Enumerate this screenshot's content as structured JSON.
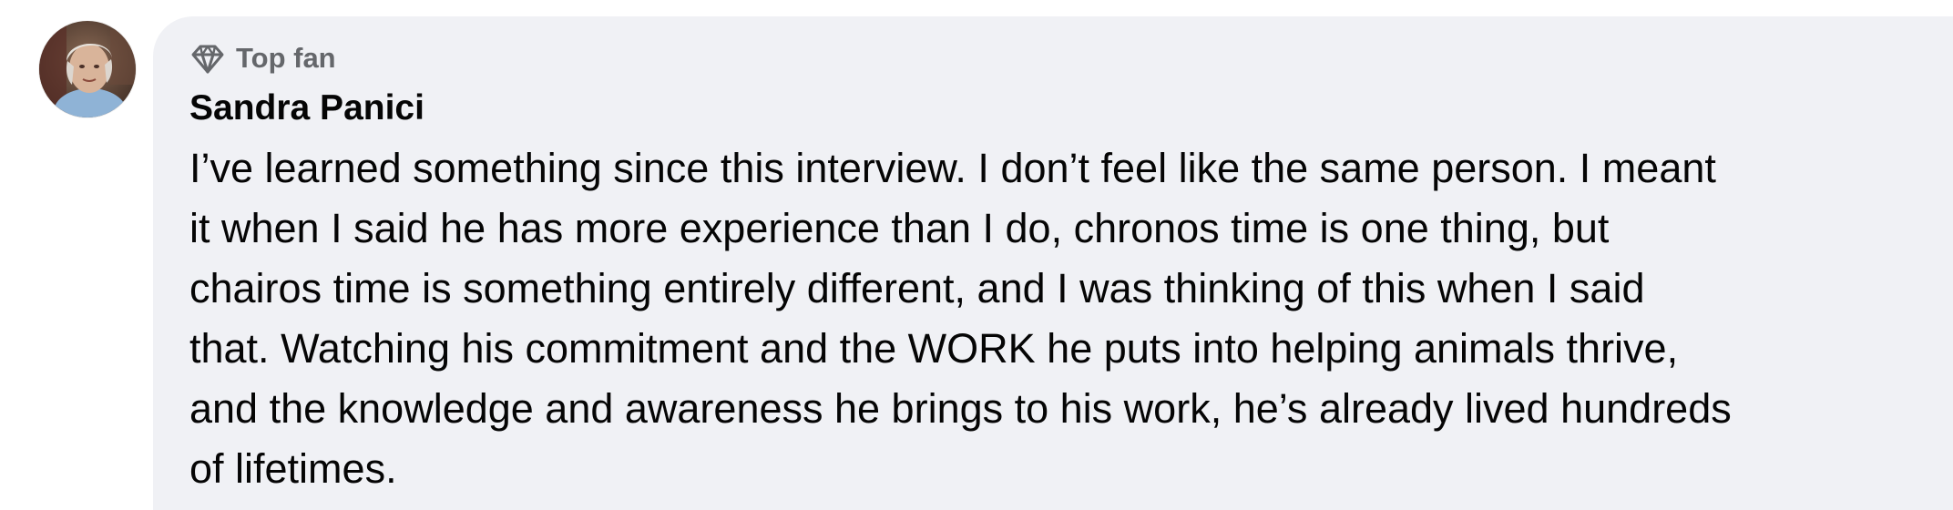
{
  "comment": {
    "badge": {
      "icon": "diamond-icon",
      "label": "Top fan"
    },
    "author": "Sandra Panici",
    "lines": [
      "I’ve learned something since this interview. I don’t feel like the same person. I meant",
      "it when I said he has more experience than I do, chronos time is one thing, but",
      "chairos time is something entirely different, and I was thinking of this when I said",
      "that. Watching his commitment and the WORK he puts into helping animals thrive,",
      "and the knowledge and awareness he brings to his work, he’s already lived hundreds",
      "of lifetimes."
    ]
  },
  "colors": {
    "bubble_background": "#f0f1f5",
    "secondary_text": "#65676b",
    "primary_text": "#050505"
  }
}
